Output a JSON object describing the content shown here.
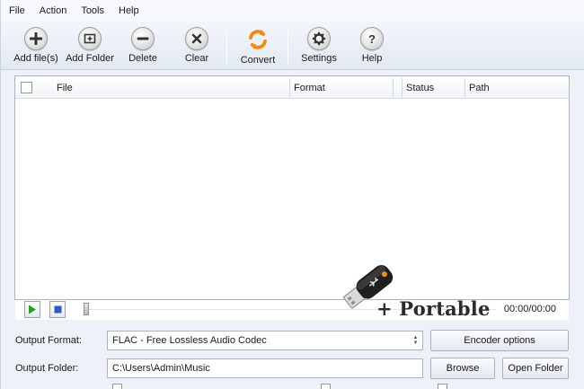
{
  "menu": [
    "File",
    "Action",
    "Tools",
    "Help"
  ],
  "toolbar": {
    "add_files": "Add file(s)",
    "add_folder": "Add Folder",
    "delete": "Delete",
    "clear": "Clear",
    "convert": "Convert",
    "settings": "Settings",
    "help": "Help"
  },
  "table": {
    "columns": [
      "File",
      "Format",
      "Status",
      "Path"
    ],
    "rows": []
  },
  "player": {
    "time": "00:00/00:00"
  },
  "overlay": {
    "portable_label": "+ Portable"
  },
  "form": {
    "output_format_label": "Output Format:",
    "output_format_value": "FLAC - Free Lossless Audio Codec",
    "encoder_options": "Encoder options",
    "output_folder_label": "Output Folder:",
    "output_folder_value": "C:\\Users\\Admin\\Music",
    "browse": "Browse",
    "open_folder": "Open Folder"
  },
  "colors": {
    "window_bg": "#eef2f8",
    "convert_accent": "#f08a1c",
    "play_green": "#2e9b2e",
    "stop_blue": "#2d5fb8"
  },
  "icons": [
    "plus-icon",
    "folder-add-icon",
    "minus-icon",
    "x-icon",
    "refresh-icon",
    "gear-icon",
    "question-icon",
    "play-icon",
    "stop-icon",
    "usb-drive-icon"
  ]
}
